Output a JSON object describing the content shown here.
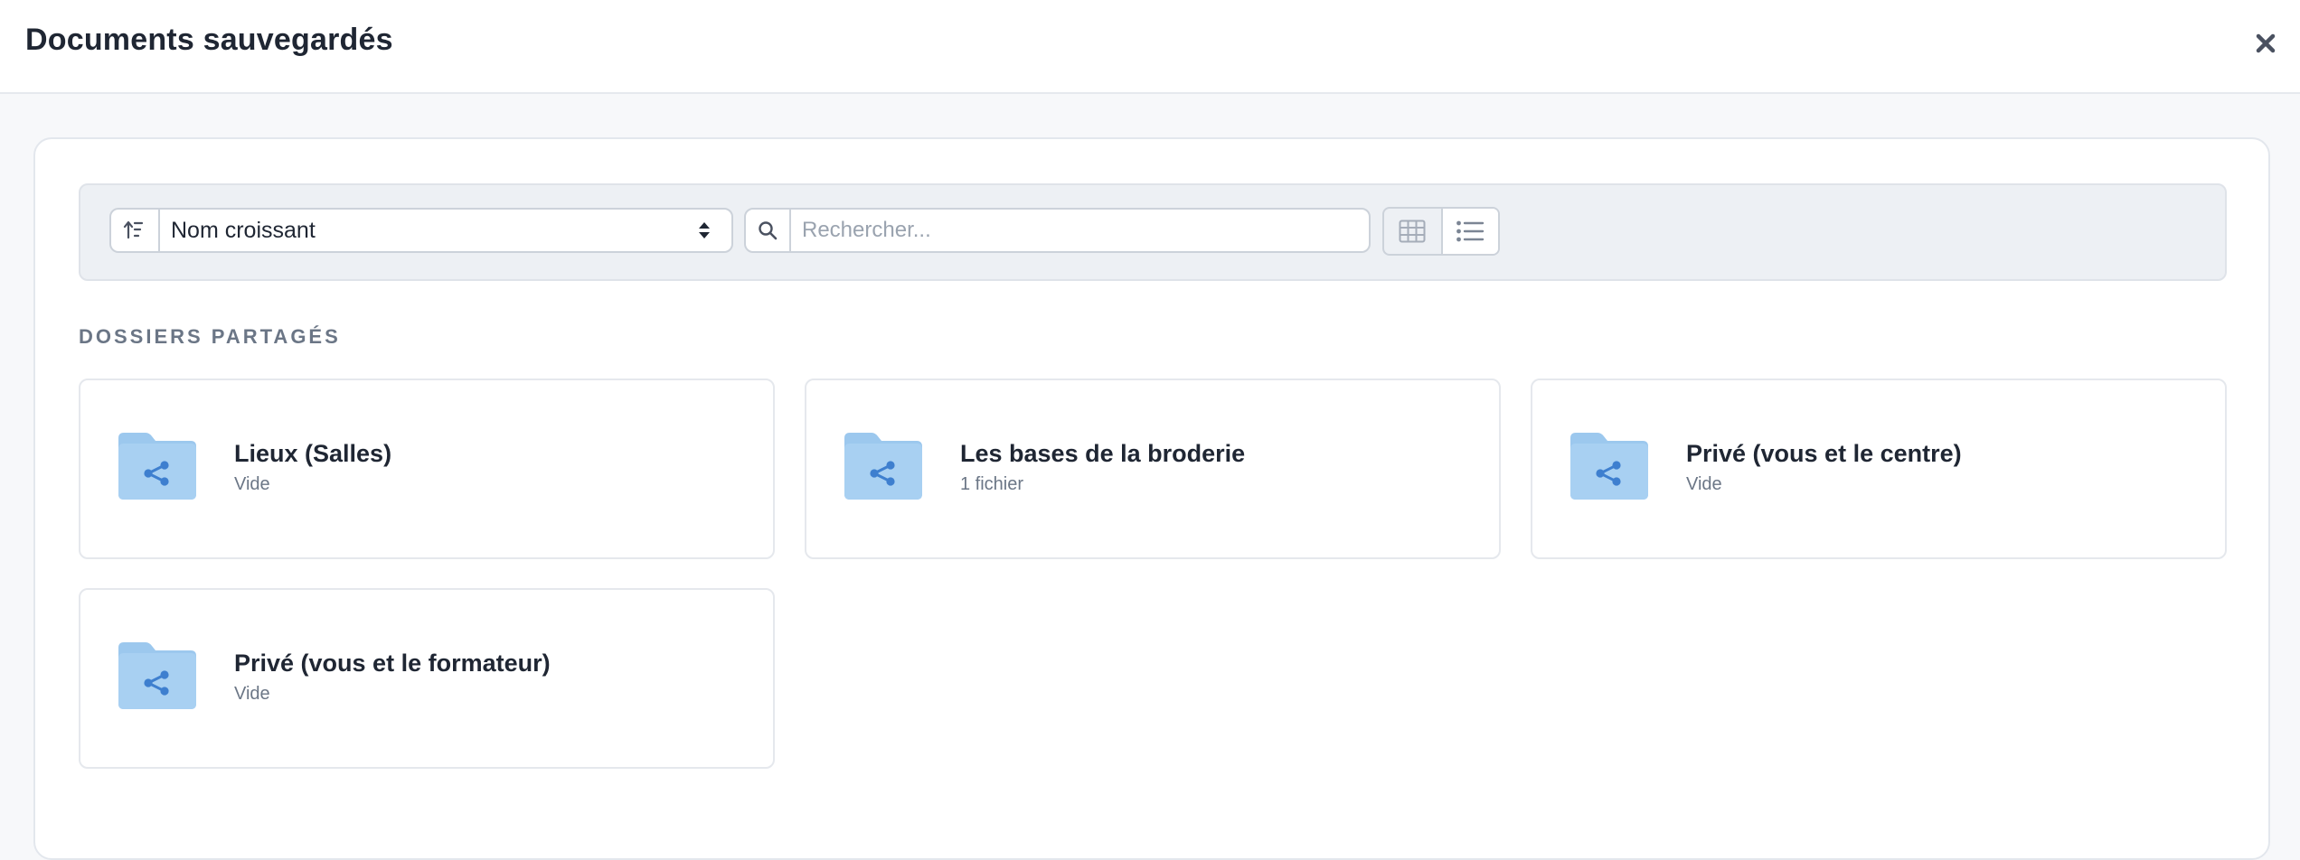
{
  "modal": {
    "title": "Documents sauvegardés",
    "close_icon": "close-icon"
  },
  "toolbar": {
    "sort_icon": "sort-ascending-icon",
    "sort_value": "Nom croissant",
    "search_icon": "search-icon",
    "search_placeholder": "Rechercher...",
    "search_value": "",
    "views": [
      {
        "name": "grid-view",
        "icon": "grid-icon",
        "active": false
      },
      {
        "name": "list-view",
        "icon": "list-icon",
        "active": true
      }
    ]
  },
  "section": {
    "title": "DOSSIERS PARTAGÉS"
  },
  "folders": [
    {
      "name": "Lieux (Salles)",
      "count": "Vide",
      "icon": "shared-folder-icon"
    },
    {
      "name": "Les bases de la broderie",
      "count": "1 fichier",
      "icon": "shared-folder-icon"
    },
    {
      "name": "Privé (vous et le centre)",
      "count": "Vide",
      "icon": "shared-folder-icon"
    },
    {
      "name": "Privé (vous et le formateur)",
      "count": "Vide",
      "icon": "shared-folder-icon"
    }
  ],
  "colors": {
    "folder_fill": "#a8d0f2",
    "folder_tab": "#9cc8ee",
    "share_glyph": "#3e7fcf",
    "title_text": "#1f2633",
    "muted_text": "#6b7686"
  }
}
